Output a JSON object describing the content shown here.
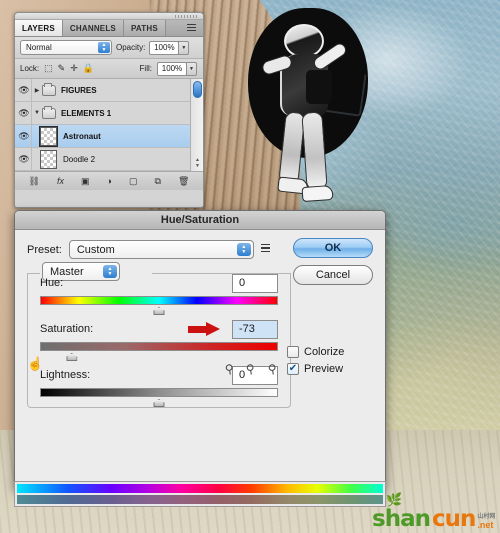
{
  "layers_panel": {
    "tabs": [
      {
        "label": "LAYERS",
        "active": true
      },
      {
        "label": "CHANNELS",
        "active": false
      },
      {
        "label": "PATHS",
        "active": false
      }
    ],
    "panel_menu_icon": "panel-menu-icon",
    "blend_mode": "Normal",
    "opacity_label": "Opacity:",
    "opacity_value": "100%",
    "lock_label": "Lock:",
    "lock_icons": [
      "lock-transparency-icon",
      "lock-image-icon",
      "lock-position-icon",
      "lock-all-icon"
    ],
    "fill_label": "Fill:",
    "fill_value": "100%",
    "layers": [
      {
        "name": "FIGURES",
        "type": "group",
        "expanded": false,
        "visible": true,
        "selected": false
      },
      {
        "name": "ELEMENTS 1",
        "type": "group",
        "expanded": true,
        "visible": true,
        "selected": false
      },
      {
        "name": "Astronaut",
        "type": "layer",
        "visible": true,
        "selected": true
      },
      {
        "name": "Doodle 2",
        "type": "layer",
        "visible": true,
        "selected": false
      }
    ],
    "footer_icons": [
      "link-layers-icon",
      "layer-style-fx-icon",
      "add-layer-mask-icon",
      "new-adjustment-layer-icon",
      "new-group-icon",
      "new-layer-icon",
      "delete-layer-icon"
    ]
  },
  "dialog": {
    "title": "Hue/Saturation",
    "preset_label": "Preset:",
    "preset_value": "Custom",
    "preset_menu_icon": "preset-options-icon",
    "ok_label": "OK",
    "cancel_label": "Cancel",
    "channel_value": "Master",
    "sliders": [
      {
        "name": "Hue:",
        "value": "0",
        "handle_percent": 50,
        "highlighted": false
      },
      {
        "name": "Saturation:",
        "value": "-73",
        "handle_percent": 13,
        "highlighted": true
      },
      {
        "name": "Lightness:",
        "value": "0",
        "handle_percent": 50,
        "highlighted": false
      }
    ],
    "annotation_arrow": "red-arrow-pointing-to-saturation-value",
    "hand_tool_icon": "on-image-adjustment-hand-icon",
    "droppers": [
      "eyedropper-icon",
      "eyedropper-plus-icon",
      "eyedropper-minus-icon"
    ],
    "colorize_label": "Colorize",
    "colorize_checked": false,
    "preview_label": "Preview",
    "preview_checked": true,
    "check_mark": "✔"
  },
  "spectrum": {
    "top_bar": "saturated-color-spectrum",
    "bottom_bar": "desaturated-color-spectrum"
  },
  "watermark": {
    "part_a": "shan",
    "part_b": "cun",
    "domain": ".net",
    "cn_text": "山村网",
    "leaf_icon": "leaf-icon"
  },
  "colors": {
    "accent_blue": "#2a74c6",
    "annotation_red": "#cc1111",
    "selection_blue": "#a9cdee",
    "highlight_field": "#cfe3f7",
    "watermark_green": "#4e9a28",
    "watermark_orange": "#e8770d"
  }
}
